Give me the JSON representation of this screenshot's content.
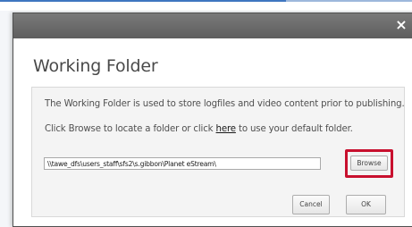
{
  "dialog": {
    "close_icon": "×",
    "title": "Working Folder",
    "description_line1": "The Working Folder is used to store logfiles and video content prior to publishing.",
    "description_line2_prefix": "Click Browse to locate a folder or click ",
    "description_line2_link": "here",
    "description_line2_suffix": " to use your default folder.",
    "path_value": "\\\\tawe_dfs\\users_staff\\sfs2\\s.gibbon\\Planet eStream\\",
    "browse_label": "Browse",
    "cancel_label": "Cancel",
    "ok_label": "OK",
    "highlight_color": "#c8102e"
  }
}
